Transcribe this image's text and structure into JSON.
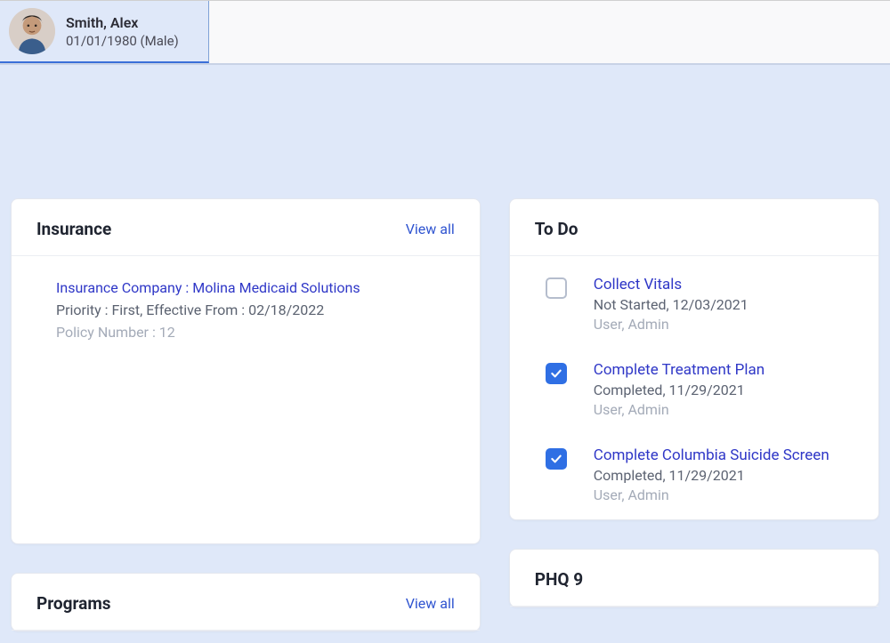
{
  "patient": {
    "name": "Smith, Alex",
    "sub": "01/01/1980 (Male)"
  },
  "insurance": {
    "title": "Insurance",
    "view_all": "View all",
    "company_line": "Insurance Company : Molina Medicaid Solutions",
    "priority_line": "Priority : First, Effective From : 02/18/2022",
    "policy_line": "Policy Number : 12"
  },
  "programs": {
    "title": "Programs",
    "view_all": "View all"
  },
  "todo": {
    "title": "To Do",
    "items": [
      {
        "done": false,
        "title": "Collect Vitals",
        "status": "Not Started, 12/03/2021",
        "user": "User, Admin"
      },
      {
        "done": true,
        "title": "Complete Treatment Plan",
        "status": "Completed, 11/29/2021",
        "user": "User, Admin"
      },
      {
        "done": true,
        "title": "Complete Columbia Suicide Screen",
        "status": "Completed, 11/29/2021",
        "user": "User, Admin"
      }
    ]
  },
  "phq9": {
    "title": "PHQ 9"
  }
}
